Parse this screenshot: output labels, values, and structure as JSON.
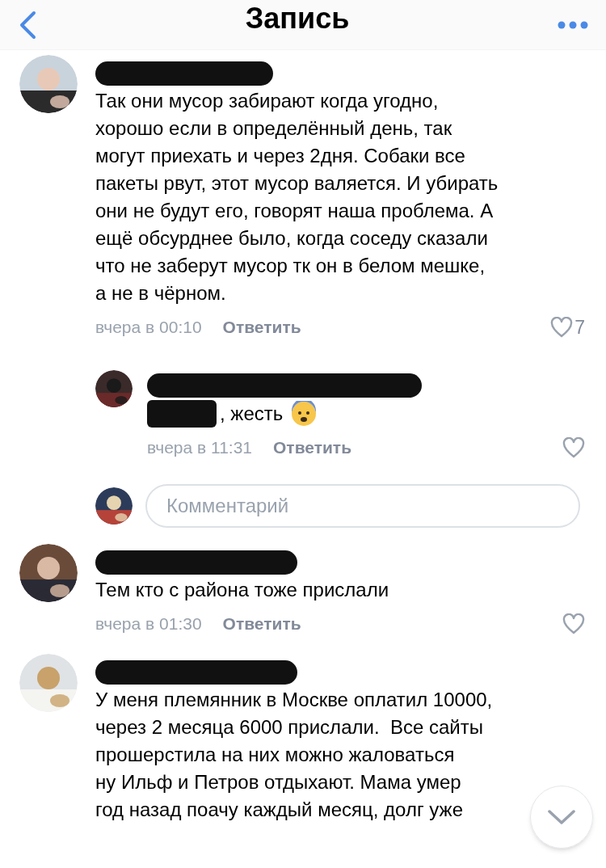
{
  "header": {
    "title": "Запись"
  },
  "items": [
    {
      "kind": "comment",
      "lines": [
        "Так они мусор забирают когда угодно,",
        "хорошо если в определённый день, так",
        "могут приехать и через 2дня. Собаки все",
        "пакеты рвут, этот мусор валяется. И убирать",
        "они не будут его, говорят наша проблема. А",
        "ещё обсурднее было, когда соседу сказали",
        "что не заберут мусор тк он в белом мешке,",
        "а не в чёрном."
      ],
      "time": "вчера в 00:10",
      "reply": "Ответить",
      "likes": "7"
    },
    {
      "kind": "reply",
      "lines": [
        ", жесть"
      ],
      "time": "вчера в 11:31",
      "reply": "Ответить"
    },
    {
      "kind": "input",
      "placeholder": "Комментарий"
    },
    {
      "kind": "comment",
      "lines": [
        "Тем кто с района тоже прислали"
      ],
      "time": "вчера в 01:30",
      "reply": "Ответить"
    },
    {
      "kind": "comment",
      "lines": [
        "У меня племянник в Москве оплатил 10000,",
        "через 2 месяца 6000 прислали.  Все сайты",
        "прошерстила на них можно жаловаться",
        "ну Ильф и Петров отдыхают. Мама умер",
        "год назад поачу каждый месяц, долг уже"
      ]
    }
  ]
}
